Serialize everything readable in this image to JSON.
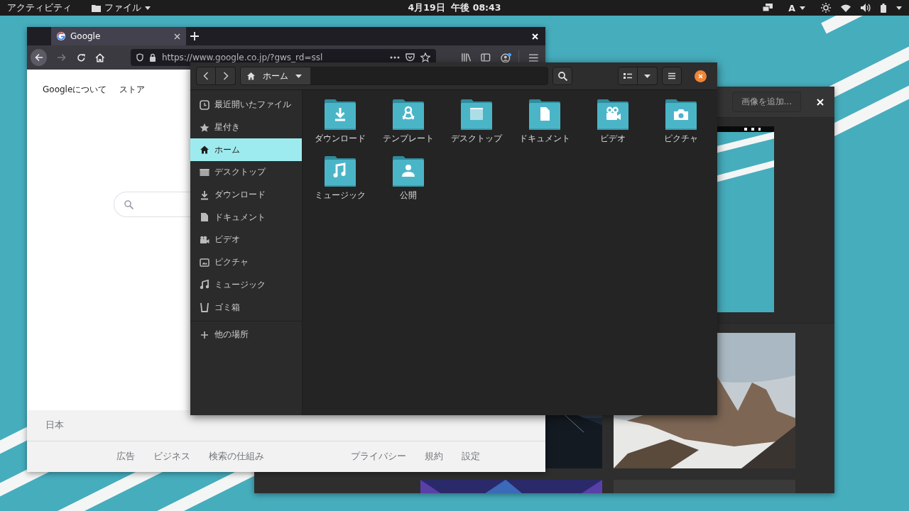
{
  "top_bar": {
    "activities": "アクティビティ",
    "app_menu": "ファイル",
    "clock": "4月19日  午後 08:43",
    "input_method": "A"
  },
  "browser": {
    "tab": {
      "title": "Google",
      "selected": true
    },
    "url": "https://www.google.co.jp/?gws_rd=ssl",
    "header_links": [
      "Googleについて",
      "ストア"
    ],
    "country": "日本",
    "footer_links_left": [
      "広告",
      "ビジネス",
      "検索の仕組み"
    ],
    "footer_links_right": [
      "プライバシー",
      "規約",
      "設定"
    ]
  },
  "files": {
    "location": "ホーム",
    "sidebar": [
      {
        "label": "最近開いたファイル",
        "selected": false
      },
      {
        "label": "星付き",
        "selected": false
      },
      {
        "label": "ホーム",
        "selected": true
      },
      {
        "label": "デスクトップ",
        "selected": false
      },
      {
        "label": "ダウンロード",
        "selected": false
      },
      {
        "label": "ドキュメント",
        "selected": false
      },
      {
        "label": "ビデオ",
        "selected": false
      },
      {
        "label": "ピクチャ",
        "selected": false
      },
      {
        "label": "ミュージック",
        "selected": false
      },
      {
        "label": "ゴミ箱",
        "selected": false
      }
    ],
    "other_places": "他の場所",
    "folders": [
      "ダウンロード",
      "テンプレート",
      "デスクトップ",
      "ドキュメント",
      "ビデオ",
      "ピクチャ",
      "ミュージック",
      "公開"
    ]
  },
  "image_window": {
    "add_button": "画像を追加..."
  }
}
